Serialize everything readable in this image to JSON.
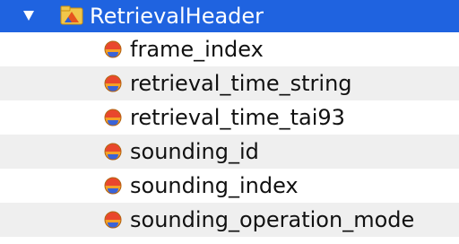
{
  "tree": {
    "group": {
      "label": "RetrievalHeader",
      "icon": "folder-group-icon",
      "expanded": true,
      "selected": true
    },
    "items": [
      {
        "label": "frame_index",
        "icon": "dataset-icon"
      },
      {
        "label": "retrieval_time_string",
        "icon": "dataset-icon"
      },
      {
        "label": "retrieval_time_tai93",
        "icon": "dataset-icon"
      },
      {
        "label": "sounding_id",
        "icon": "dataset-icon"
      },
      {
        "label": "sounding_index",
        "icon": "dataset-icon"
      },
      {
        "label": "sounding_operation_mode",
        "icon": "dataset-icon"
      }
    ]
  },
  "colors": {
    "selection": "#1f63e0",
    "stripe": "#efefef"
  }
}
